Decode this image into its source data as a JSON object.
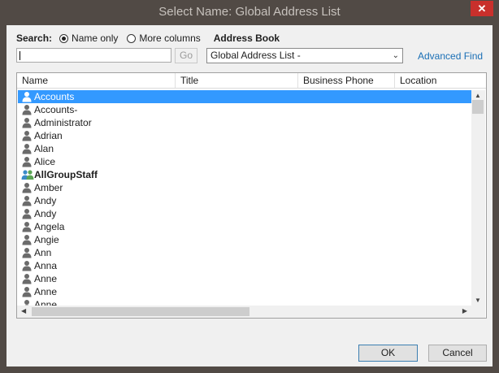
{
  "window": {
    "title": "Select Name: Global Address List",
    "close_glyph": "✕"
  },
  "search": {
    "label": "Search:",
    "option_name_only": "Name only",
    "option_more_columns": "More columns",
    "selected_option": "Name only",
    "input_value": "",
    "go_label": "Go"
  },
  "address_book": {
    "label": "Address Book",
    "selected": "Global Address List -",
    "advanced_find": "Advanced Find"
  },
  "table": {
    "columns": [
      "Name",
      "Title",
      "Business Phone",
      "Location"
    ],
    "rows": [
      {
        "name": "Accounts",
        "icon": "person-icon",
        "selected": true,
        "bold": false
      },
      {
        "name": "Accounts-",
        "icon": "person-icon",
        "selected": false,
        "bold": false
      },
      {
        "name": "Administrator",
        "icon": "person-icon",
        "selected": false,
        "bold": false
      },
      {
        "name": "Adrian",
        "icon": "person-icon",
        "selected": false,
        "bold": false
      },
      {
        "name": "Alan",
        "icon": "person-icon",
        "selected": false,
        "bold": false
      },
      {
        "name": "Alice",
        "icon": "person-icon",
        "selected": false,
        "bold": false
      },
      {
        "name": "AllGroupStaff",
        "icon": "group-icon",
        "selected": false,
        "bold": true
      },
      {
        "name": "Amber",
        "icon": "person-icon",
        "selected": false,
        "bold": false
      },
      {
        "name": "Andy",
        "icon": "person-icon",
        "selected": false,
        "bold": false
      },
      {
        "name": "Andy",
        "icon": "person-icon",
        "selected": false,
        "bold": false
      },
      {
        "name": "Angela",
        "icon": "person-icon",
        "selected": false,
        "bold": false
      },
      {
        "name": "Angie",
        "icon": "person-icon",
        "selected": false,
        "bold": false
      },
      {
        "name": "Ann",
        "icon": "person-icon",
        "selected": false,
        "bold": false
      },
      {
        "name": "Anna",
        "icon": "person-icon",
        "selected": false,
        "bold": false
      },
      {
        "name": "Anne",
        "icon": "person-icon",
        "selected": false,
        "bold": false
      },
      {
        "name": "Anne",
        "icon": "person-icon",
        "selected": false,
        "bold": false
      },
      {
        "name": "Anne",
        "icon": "person-icon",
        "selected": false,
        "bold": false
      }
    ]
  },
  "buttons": {
    "ok": "OK",
    "cancel": "Cancel"
  },
  "colors": {
    "selection": "#3399ff",
    "link": "#1a6fb5",
    "frame": "#514a45",
    "close": "#c9302c"
  }
}
